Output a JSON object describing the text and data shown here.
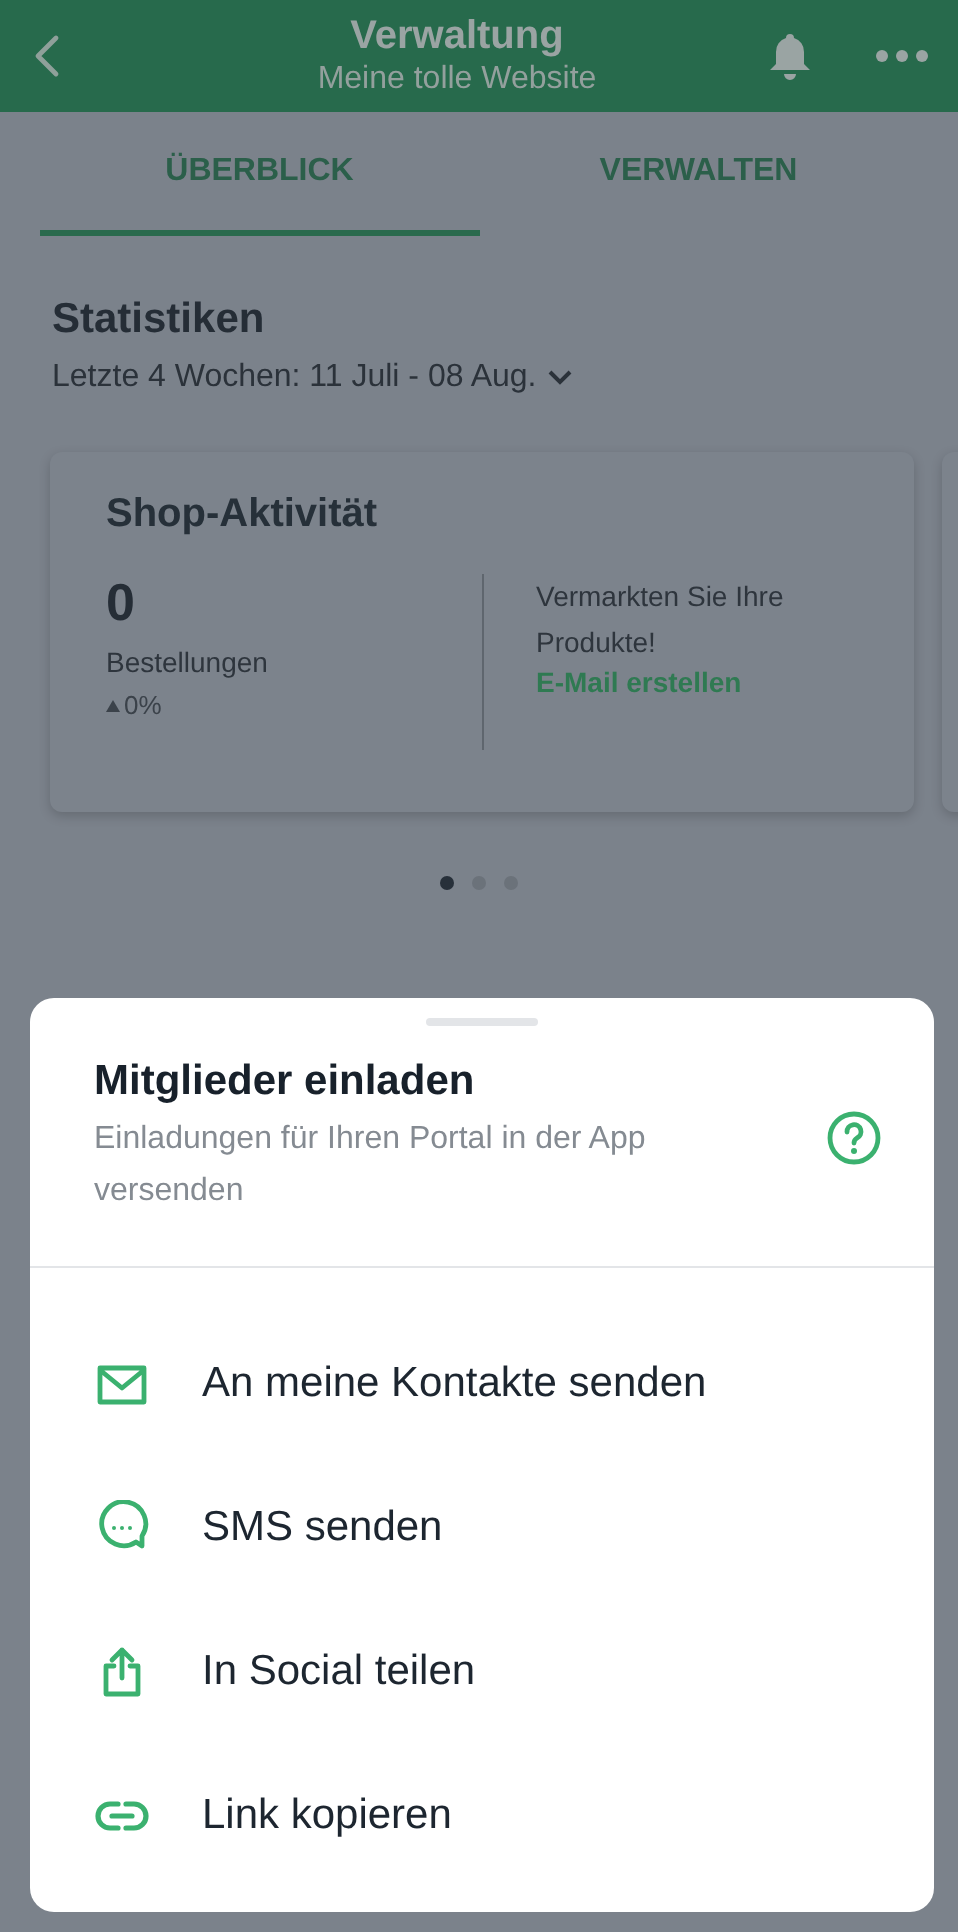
{
  "header": {
    "title": "Verwaltung",
    "subtitle": "Meine tolle Website"
  },
  "tabs": [
    {
      "label": "ÜBERBLICK",
      "selected": true
    },
    {
      "label": "VERWALTEN",
      "selected": false
    }
  ],
  "stats": {
    "title": "Statistiken",
    "range": "Letzte 4 Wochen: 11 Juli - 08 Aug."
  },
  "card": {
    "title": "Shop-Aktivität",
    "value": "0",
    "value_label": "Bestellungen",
    "change": "0%",
    "promo": "Vermarkten Sie Ihre Produkte!",
    "link": "E-Mail erstellen"
  },
  "pager": [
    {
      "selected": true
    },
    {
      "selected": false
    },
    {
      "selected": false
    }
  ],
  "sheet": {
    "title": "Mitglieder einladen",
    "subtitle": "Einladungen für Ihren Portal in der App versenden",
    "actions": [
      {
        "kind": "mail",
        "label": "An meine Kontakte senden"
      },
      {
        "kind": "sms",
        "label": "SMS senden"
      },
      {
        "kind": "share",
        "label": "In Social teilen"
      },
      {
        "kind": "link",
        "label": "Link kopieren"
      }
    ]
  }
}
